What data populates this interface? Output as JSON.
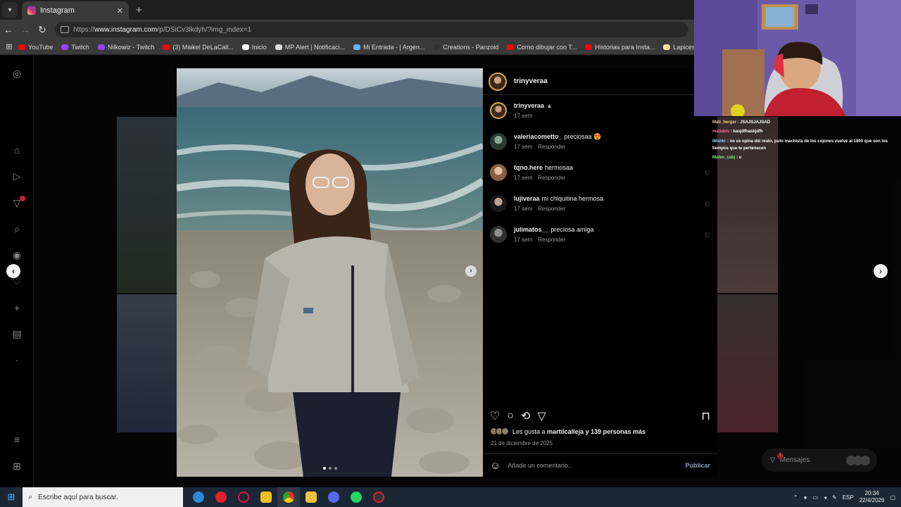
{
  "browser": {
    "tab_title": "Instagram",
    "tab_close": "✕",
    "new_tab": "+",
    "url_prefix": "https://",
    "url_host": "www.instagram.com",
    "url_path": "/p/DSiCv3lkdyh/?img_index=1",
    "bookmarks": [
      {
        "label": "YouTube",
        "color": "#ff0000"
      },
      {
        "label": "Twitch",
        "color": "#9146ff"
      },
      {
        "label": "Nilkowiz - Twitch",
        "color": "#9146ff"
      },
      {
        "label": "(3) Maikel DeLaCall...",
        "color": "#ff0000"
      },
      {
        "label": "Inicio",
        "color": "#ffffff"
      },
      {
        "label": "MP Alert | Notificaci...",
        "color": "#dddddd"
      },
      {
        "label": "Mi Entrada - | Argen...",
        "color": "#6ab0ff"
      },
      {
        "label": "Creations - Panzoid",
        "color": "#333333"
      },
      {
        "label": "Como dibujar con T...",
        "color": "#ff0000"
      },
      {
        "label": "Historias para Insta...",
        "color": "#ff0000"
      },
      {
        "label": "Lapices Prismacolor...",
        "color": "#f0e0a0"
      }
    ]
  },
  "post": {
    "author": "trinyveraa",
    "caption_user": "trinyveraa",
    "caption_text": "▲",
    "caption_time": "17 sem",
    "comments": [
      {
        "user": "valeriacometto_",
        "text": "preciosaa 😍",
        "time": "17 sem",
        "reply": "Responder"
      },
      {
        "user": "tqno.here",
        "text": "hermosaa",
        "time": "17 sem",
        "reply": "Responder"
      },
      {
        "user": "lujiveraa",
        "text": "mi chiquitina hermosa",
        "time": "17 sem",
        "reply": "Responder"
      },
      {
        "user": "julimatos__",
        "text": "preciosa amiga",
        "time": "17 sem",
        "reply": "Responder"
      }
    ],
    "likes_prefix": "Les gusta a",
    "likes_user": "martiicalleja",
    "likes_suffix": "y 139 personas más",
    "date": "21 de diciembre de 2025",
    "comment_placeholder": "Añade un comentario...",
    "publish_label": "Publicar"
  },
  "messages_label": "Mensajes",
  "messages_badge": "1",
  "chat": [
    {
      "user": "Mati_berger",
      "text": "JSAJSJAJSAD"
    },
    {
      "user": "matidelv",
      "text": "kasjdfhaskjdfh"
    },
    {
      "user": "IMshkr",
      "text": "no se opina del resto, puto machista de los cojones vuelve al 1800 que son los tiempos que te pertenecen"
    },
    {
      "user": "Matex_cabj",
      "text": "u"
    }
  ],
  "taskbar": {
    "search_placeholder": "Escribe aquí para buscar.",
    "language": "ESP",
    "time": "20:34",
    "date": "22/4/2026"
  }
}
